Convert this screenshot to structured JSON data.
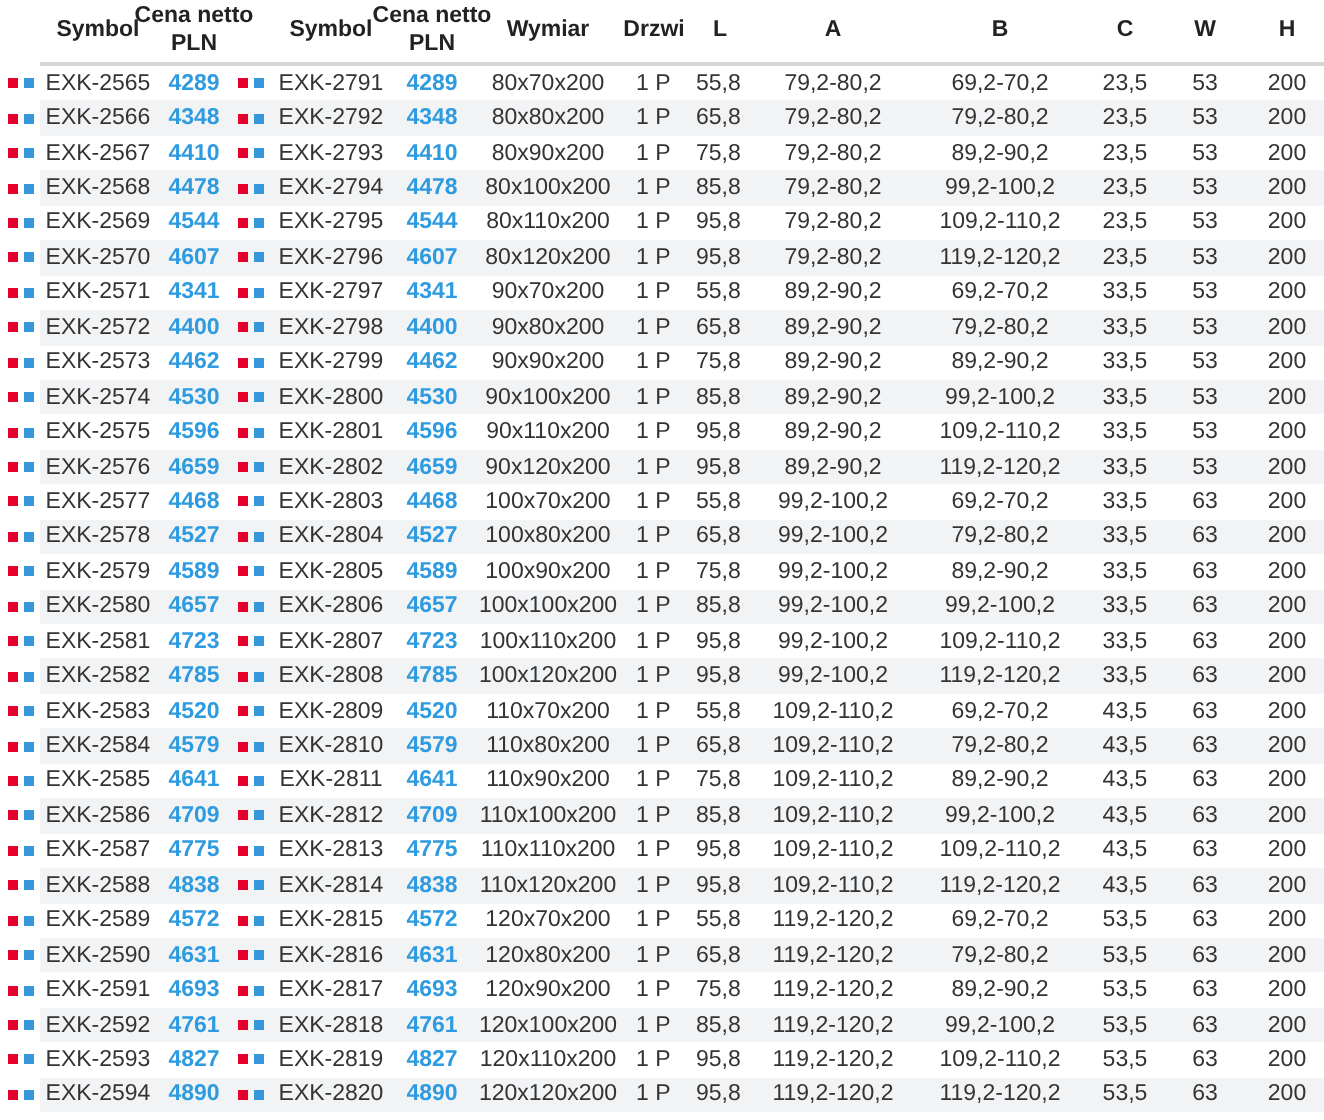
{
  "table": {
    "columns": [
      "Symbol",
      "Cena netto PLN",
      "Symbol",
      "Cena netto PLN",
      "Wymiar",
      "Drzwi",
      "L",
      "A",
      "B",
      "C",
      "W",
      "H"
    ],
    "rows": [
      {
        "cells": [
          "EXK-2565",
          "4289",
          "EXK-2791",
          "4289",
          "80x70x200",
          "1 P",
          "55,8",
          "79,2-80,2",
          "69,2-70,2",
          "23,5",
          "53",
          "200"
        ]
      },
      {
        "cells": [
          "EXK-2566",
          "4348",
          "EXK-2792",
          "4348",
          "80x80x200",
          "1 P",
          "65,8",
          "79,2-80,2",
          "79,2-80,2",
          "23,5",
          "53",
          "200"
        ]
      },
      {
        "cells": [
          "EXK-2567",
          "4410",
          "EXK-2793",
          "4410",
          "80x90x200",
          "1 P",
          "75,8",
          "79,2-80,2",
          "89,2-90,2",
          "23,5",
          "53",
          "200"
        ]
      },
      {
        "cells": [
          "EXK-2568",
          "4478",
          "EXK-2794",
          "4478",
          "80x100x200",
          "1 P",
          "85,8",
          "79,2-80,2",
          "99,2-100,2",
          "23,5",
          "53",
          "200"
        ]
      },
      {
        "cells": [
          "EXK-2569",
          "4544",
          "EXK-2795",
          "4544",
          "80x110x200",
          "1 P",
          "95,8",
          "79,2-80,2",
          "109,2-110,2",
          "23,5",
          "53",
          "200"
        ]
      },
      {
        "cells": [
          "EXK-2570",
          "4607",
          "EXK-2796",
          "4607",
          "80x120x200",
          "1 P",
          "95,8",
          "79,2-80,2",
          "119,2-120,2",
          "23,5",
          "53",
          "200"
        ]
      },
      {
        "cells": [
          "EXK-2571",
          "4341",
          "EXK-2797",
          "4341",
          "90x70x200",
          "1 P",
          "55,8",
          "89,2-90,2",
          "69,2-70,2",
          "33,5",
          "53",
          "200"
        ]
      },
      {
        "cells": [
          "EXK-2572",
          "4400",
          "EXK-2798",
          "4400",
          "90x80x200",
          "1 P",
          "65,8",
          "89,2-90,2",
          "79,2-80,2",
          "33,5",
          "53",
          "200"
        ]
      },
      {
        "cells": [
          "EXK-2573",
          "4462",
          "EXK-2799",
          "4462",
          "90x90x200",
          "1 P",
          "75,8",
          "89,2-90,2",
          "89,2-90,2",
          "33,5",
          "53",
          "200"
        ]
      },
      {
        "cells": [
          "EXK-2574",
          "4530",
          "EXK-2800",
          "4530",
          "90x100x200",
          "1 P",
          "85,8",
          "89,2-90,2",
          "99,2-100,2",
          "33,5",
          "53",
          "200"
        ]
      },
      {
        "cells": [
          "EXK-2575",
          "4596",
          "EXK-2801",
          "4596",
          "90x110x200",
          "1 P",
          "95,8",
          "89,2-90,2",
          "109,2-110,2",
          "33,5",
          "53",
          "200"
        ]
      },
      {
        "cells": [
          "EXK-2576",
          "4659",
          "EXK-2802",
          "4659",
          "90x120x200",
          "1 P",
          "95,8",
          "89,2-90,2",
          "119,2-120,2",
          "33,5",
          "53",
          "200"
        ]
      },
      {
        "cells": [
          "EXK-2577",
          "4468",
          "EXK-2803",
          "4468",
          "100x70x200",
          "1 P",
          "55,8",
          "99,2-100,2",
          "69,2-70,2",
          "33,5",
          "63",
          "200"
        ]
      },
      {
        "cells": [
          "EXK-2578",
          "4527",
          "EXK-2804",
          "4527",
          "100x80x200",
          "1 P",
          "65,8",
          "99,2-100,2",
          "79,2-80,2",
          "33,5",
          "63",
          "200"
        ]
      },
      {
        "cells": [
          "EXK-2579",
          "4589",
          "EXK-2805",
          "4589",
          "100x90x200",
          "1 P",
          "75,8",
          "99,2-100,2",
          "89,2-90,2",
          "33,5",
          "63",
          "200"
        ]
      },
      {
        "cells": [
          "EXK-2580",
          "4657",
          "EXK-2806",
          "4657",
          "100x100x200",
          "1 P",
          "85,8",
          "99,2-100,2",
          "99,2-100,2",
          "33,5",
          "63",
          "200"
        ]
      },
      {
        "cells": [
          "EXK-2581",
          "4723",
          "EXK-2807",
          "4723",
          "100x110x200",
          "1 P",
          "95,8",
          "99,2-100,2",
          "109,2-110,2",
          "33,5",
          "63",
          "200"
        ]
      },
      {
        "cells": [
          "EXK-2582",
          "4785",
          "EXK-2808",
          "4785",
          "100x120x200",
          "1 P",
          "95,8",
          "99,2-100,2",
          "119,2-120,2",
          "33,5",
          "63",
          "200"
        ]
      },
      {
        "cells": [
          "EXK-2583",
          "4520",
          "EXK-2809",
          "4520",
          "110x70x200",
          "1 P",
          "55,8",
          "109,2-110,2",
          "69,2-70,2",
          "43,5",
          "63",
          "200"
        ]
      },
      {
        "cells": [
          "EXK-2584",
          "4579",
          "EXK-2810",
          "4579",
          "110x80x200",
          "1 P",
          "65,8",
          "109,2-110,2",
          "79,2-80,2",
          "43,5",
          "63",
          "200"
        ]
      },
      {
        "cells": [
          "EXK-2585",
          "4641",
          "EXK-2811",
          "4641",
          "110x90x200",
          "1 P",
          "75,8",
          "109,2-110,2",
          "89,2-90,2",
          "43,5",
          "63",
          "200"
        ]
      },
      {
        "cells": [
          "EXK-2586",
          "4709",
          "EXK-2812",
          "4709",
          "110x100x200",
          "1 P",
          "85,8",
          "109,2-110,2",
          "99,2-100,2",
          "43,5",
          "63",
          "200"
        ]
      },
      {
        "cells": [
          "EXK-2587",
          "4775",
          "EXK-2813",
          "4775",
          "110x110x200",
          "1 P",
          "95,8",
          "109,2-110,2",
          "109,2-110,2",
          "43,5",
          "63",
          "200"
        ]
      },
      {
        "cells": [
          "EXK-2588",
          "4838",
          "EXK-2814",
          "4838",
          "110x120x200",
          "1 P",
          "95,8",
          "109,2-110,2",
          "119,2-120,2",
          "43,5",
          "63",
          "200"
        ]
      },
      {
        "cells": [
          "EXK-2589",
          "4572",
          "EXK-2815",
          "4572",
          "120x70x200",
          "1 P",
          "55,8",
          "119,2-120,2",
          "69,2-70,2",
          "53,5",
          "63",
          "200"
        ]
      },
      {
        "cells": [
          "EXK-2590",
          "4631",
          "EXK-2816",
          "4631",
          "120x80x200",
          "1 P",
          "65,8",
          "119,2-120,2",
          "79,2-80,2",
          "53,5",
          "63",
          "200"
        ]
      },
      {
        "cells": [
          "EXK-2591",
          "4693",
          "EXK-2817",
          "4693",
          "120x90x200",
          "1 P",
          "75,8",
          "119,2-120,2",
          "89,2-90,2",
          "53,5",
          "63",
          "200"
        ]
      },
      {
        "cells": [
          "EXK-2592",
          "4761",
          "EXK-2818",
          "4761",
          "120x100x200",
          "1 P",
          "85,8",
          "119,2-120,2",
          "99,2-100,2",
          "53,5",
          "63",
          "200"
        ]
      },
      {
        "cells": [
          "EXK-2593",
          "4827",
          "EXK-2819",
          "4827",
          "120x110x200",
          "1 P",
          "95,8",
          "119,2-120,2",
          "109,2-110,2",
          "53,5",
          "63",
          "200"
        ]
      },
      {
        "cells": [
          "EXK-2594",
          "4890",
          "EXK-2820",
          "4890",
          "120x120x200",
          "1 P",
          "95,8",
          "119,2-120,2",
          "119,2-120,2",
          "53,5",
          "63",
          "200"
        ]
      }
    ]
  }
}
